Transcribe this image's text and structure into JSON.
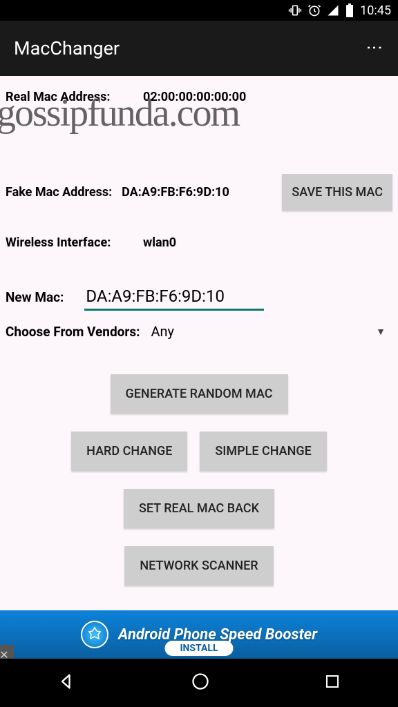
{
  "statusbar": {
    "time": "10:45"
  },
  "appbar": {
    "title": "MacChanger"
  },
  "fields": {
    "real_mac_label": "Real Mac Address:",
    "real_mac_value": "02:00:00:00:00:00",
    "fake_mac_label": "Fake Mac Address:",
    "fake_mac_value": "DA:A9:FB:F6:9D:10",
    "save_btn": "SAVE THIS MAC",
    "wireless_label": "Wireless Interface:",
    "wireless_value": "wlan0",
    "new_mac_label": "New Mac:",
    "new_mac_value": "DA:A9:FB:F6:9D:10",
    "vendors_label": "Choose From Vendors:",
    "vendors_value": "Any"
  },
  "buttons": {
    "generate": "GENERATE RANDOM MAC",
    "hard": "HARD CHANGE",
    "simple": "SIMPLE CHANGE",
    "setreal": "SET REAL MAC BACK",
    "scanner": "NETWORK SCANNER"
  },
  "ad": {
    "text": "Android Phone Speed Booster",
    "install": "INSTALL"
  },
  "watermark": "gossipfunda.com"
}
